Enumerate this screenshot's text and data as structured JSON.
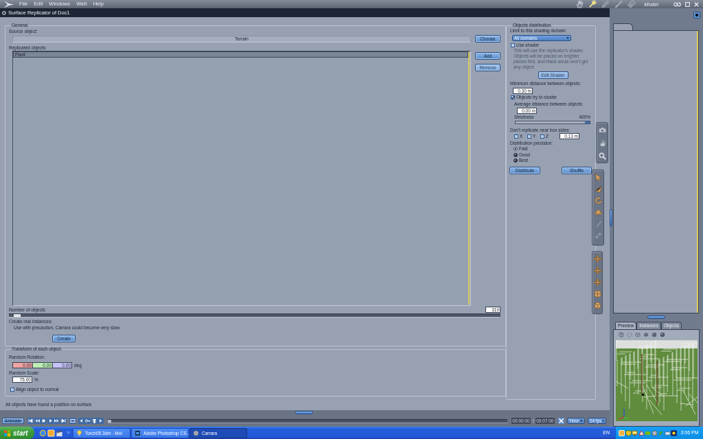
{
  "menu_bar": {
    "items": [
      "File",
      "Edit",
      "Windows",
      "Web",
      "Help"
    ],
    "rooms": [
      {
        "kind": "hand",
        "selected": false
      },
      {
        "kind": "wrench",
        "selected": true
      },
      {
        "kind": "pencil",
        "selected": false
      },
      {
        "kind": "brush",
        "selected": false
      },
      {
        "kind": "eraser",
        "selected": false
      }
    ],
    "room_title": "Model"
  },
  "dialog": {
    "title": "Surface Replicator of Doc1"
  },
  "general": {
    "title": "General",
    "source_label": "Source object:",
    "source_value": "Terrain",
    "choose_button": "Choose",
    "replicated_label": "Replicated objects:",
    "replicated_items": [
      {
        "name": "Plant",
        "selected": true
      }
    ],
    "add_button": "Add",
    "remove_button": {
      "label": "Remove",
      "disabled": true
    },
    "number_label": "Number of objects",
    "number_value": "319",
    "number_slider": {
      "level": 0.01
    },
    "create_label": "Create real instances:",
    "create_note": "Use with precaution, Carrara could become very slow.",
    "create_button": "Create"
  },
  "transform": {
    "title": "Transform of each object",
    "rotation_label": "Random Rotation:",
    "rotation_values": [
      {
        "value": "0.00",
        "color": "#f2a3a3"
      },
      {
        "value": "0.00",
        "color": "#bdf0b5"
      },
      {
        "value": "0.00",
        "color": "#c6c3f7"
      }
    ],
    "rotation_unit": "deg",
    "scale_label": "Random Scale:",
    "scale_value": "75.00",
    "scale_unit": "%",
    "align": {
      "label": "Align object to normal",
      "checked": false
    }
  },
  "status_bar": "All objects have found a position on surface",
  "distribution": {
    "title": "Objects distribution",
    "domain_label": "Limit to this shading domain:",
    "domain_value": "All domains",
    "use_shader": {
      "label": "Use shader",
      "checked": false
    },
    "shader_note": "This will use the replicator's shader. Objects will be placed on brighter places first, and black areas won't get any object.",
    "edit_shader_button": {
      "label": "Edit Shader",
      "disabled": true
    },
    "min_distance_label": "Minimum distance between objects:",
    "min_distance_value": "0.30 m",
    "cluster": {
      "label": "Objects try to cluster",
      "checked": true
    },
    "avg_distance_label": "Average distance between objects",
    "avg_distance_value": "0.00 m",
    "strictness": {
      "label": "Strictness",
      "reading": "400%",
      "level": 1
    },
    "box_sides_label": "Don't replicate near box sides:",
    "box_sides": [
      {
        "label": "X",
        "checked": false
      },
      {
        "label": "Y",
        "checked": false
      },
      {
        "label": "Z",
        "checked": false
      }
    ],
    "box_sides_value": "0.13 m",
    "precision_label": "Distribution precision:",
    "precision_options": [
      {
        "label": "Fast",
        "selected": true
      },
      {
        "label": "Good",
        "selected": false
      },
      {
        "label": "Best",
        "selected": false
      }
    ],
    "distribute_button": "Distribute",
    "shuffle_button": "Shuffle"
  },
  "tool_palettes": [
    {
      "tools": [
        {
          "kind": "camera",
          "disabled": false
        },
        {
          "kind": "hand",
          "disabled": false
        },
        {
          "kind": "search",
          "disabled": false
        }
      ]
    },
    {
      "tools": [
        {
          "kind": "arrow",
          "disabled": false
        },
        {
          "kind": "cone",
          "disabled": false
        },
        {
          "kind": "rotate",
          "disabled": false
        },
        {
          "kind": "planet",
          "disabled": false
        },
        {
          "kind": "pen",
          "disabled": true
        },
        {
          "kind": "diamonds",
          "disabled": true
        }
      ]
    },
    {
      "tools": [
        {
          "kind": "move",
          "disabled": false
        },
        {
          "kind": "move",
          "disabled": false
        },
        {
          "kind": "move",
          "disabled": false
        },
        {
          "kind": "trackball",
          "disabled": false
        },
        {
          "kind": "cube",
          "disabled": false
        }
      ]
    }
  ],
  "preview_panel": {
    "tabs": [
      {
        "label": "Preview",
        "selected": true
      },
      {
        "label": "Instances",
        "selected": false
      },
      {
        "label": "Objects",
        "selected": false
      }
    ]
  },
  "timeline": {
    "animate_button": "Animate",
    "current_time": "00:00:00",
    "separator": "/",
    "end_time": "00:07:00",
    "time_mode": "Time",
    "fps": "24 fps"
  },
  "taskbar": {
    "start": "start",
    "tasks": [
      {
        "label": "Torch05.3dm - MoI",
        "kind": "bulb",
        "selected": false
      },
      {
        "label": "Adobe Photoshop CS...",
        "kind": "app",
        "selected": false
      },
      {
        "label": "Carrara",
        "kind": "gear",
        "selected": true
      }
    ],
    "language": "EN",
    "clock": "3:06 PM"
  }
}
